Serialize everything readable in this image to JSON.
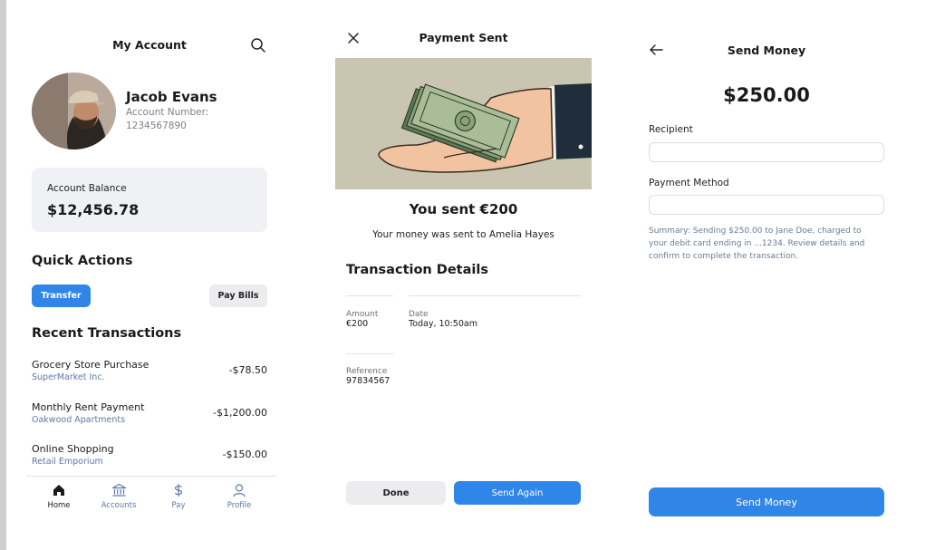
{
  "colors": {
    "accent": "#2f86e8",
    "card_bg": "#f0f1f4",
    "muted_text": "#5d79a6"
  },
  "account": {
    "title": "My Account",
    "search_icon": "search-icon",
    "user_name": "Jacob Evans",
    "account_number_label": "Account Number:",
    "account_number": "1234567890",
    "balance_label": "Account Balance",
    "balance": "$12,456.78",
    "quick_actions_title": "Quick Actions",
    "transfer_label": "Transfer",
    "pay_bills_label": "Pay Bills",
    "recent_title": "Recent Transactions",
    "transactions": [
      {
        "name": "Grocery Store Purchase",
        "merchant": "SuperMarket Inc.",
        "amount": "-$78.50"
      },
      {
        "name": "Monthly Rent Payment",
        "merchant": "Oakwood Apartments",
        "amount": "-$1,200.00"
      },
      {
        "name": "Online Shopping",
        "merchant": "Retail Emporium",
        "amount": "-$150.00"
      }
    ],
    "nav": [
      {
        "label": "Home",
        "icon": "home-icon",
        "active": true
      },
      {
        "label": "Accounts",
        "icon": "bank-icon",
        "active": false
      },
      {
        "label": "Pay",
        "icon": "dollar-icon",
        "active": false
      },
      {
        "label": "Profile",
        "icon": "user-icon",
        "active": false
      }
    ]
  },
  "payment_sent": {
    "close_icon": "close-icon",
    "title": "Payment Sent",
    "headline": "You sent €200",
    "subtitle": "Your money was sent to Amelia Hayes",
    "details_title": "Transaction Details",
    "amount_label": "Amount",
    "amount_value": "€200",
    "date_label": "Date",
    "date_value": "Today, 10:50am",
    "reference_label": "Reference",
    "reference_value": "97834567",
    "done_label": "Done",
    "send_again_label": "Send Again"
  },
  "send_money": {
    "back_icon": "arrow-left-icon",
    "title": "Send Money",
    "amount": "$250.00",
    "recipient_label": "Recipient",
    "recipient_value": "",
    "payment_method_label": "Payment Method",
    "payment_method_value": "",
    "summary": "Summary: Sending $250.00 to Jane Doe, charged to your debit card ending in ...1234. Review details and confirm to complete the transaction.",
    "send_label": "Send Money"
  }
}
